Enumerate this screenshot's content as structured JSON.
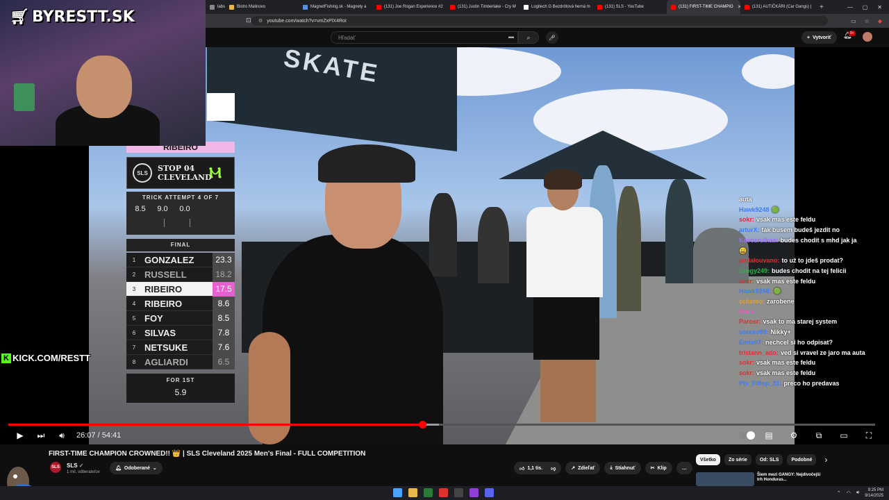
{
  "browser": {
    "tabs": [
      {
        "label": "labs",
        "color": "#888"
      },
      {
        "label": "Bistro Malinovo",
        "color": "#e8b84a"
      },
      {
        "label": "MagnetFishing.sk - Magnety a",
        "color": "#5a8de0"
      },
      {
        "label": "(131) Joe Rogan Experience #2",
        "color": "#ff0000"
      },
      {
        "label": "(131) Justin Timberlake - Cry M",
        "color": "#ff0000"
      },
      {
        "label": "Logitech G Bezdrôtová herná m",
        "color": "#ffffff"
      },
      {
        "label": "(131) SLS - YouTube",
        "color": "#ff0000"
      },
      {
        "label": "(131) FIRST-TIME CHAMPIO",
        "color": "#ff0000",
        "active": true
      },
      {
        "label": "(131) AUTIČKÁRI (Car Gangs) |",
        "color": "#ff0000"
      }
    ],
    "new_tab": "+",
    "window_controls": [
      "—",
      "▢",
      "✕"
    ],
    "url": "youtube.com/watch?v=vmZxPlX4RoI"
  },
  "youtube": {
    "search_placeholder": "Hľadať",
    "create_label": "Vytvoriť",
    "notif_badge": "9+",
    "video_title": "FIRST-TIME CHAMPION CROWNED!! 👑 | SLS Cleveland 2025 Men's Final - FULL COMPETITION",
    "channel": {
      "name": "SLS",
      "subs": "1 mil. odberateľov",
      "avatar_text": "SLS"
    },
    "subscribed_label": "Odoberané",
    "actions": {
      "likes": "1,1 tis.",
      "share": "Zdieľať",
      "download": "Stiahnuť",
      "clip": "Klip",
      "more": "…"
    },
    "chips": [
      "Všetko",
      "Zo série",
      "Od: SLS",
      "Podobné"
    ],
    "recommended_title": "Šiem mezi GANGY: Nejdivočejší trh Honduras..."
  },
  "player": {
    "current_time": "26:07",
    "duration": "54:41",
    "progress_fraction": 0.4776,
    "buffered_fraction": 0.497
  },
  "scoreboard": {
    "current_name": "RIBEIRO",
    "event_logo": "SLS",
    "stop_line1": "STOP 04",
    "stop_line2": "CLEVELAND",
    "trick_title": "TRICK ATTEMPT 4 OF 7",
    "trick_scores": [
      "8.5",
      "9.0",
      "0.0"
    ],
    "final_title": "FINAL",
    "rows": [
      {
        "pos": "1",
        "name": "GONZALEZ",
        "score": "23.3",
        "style": ""
      },
      {
        "pos": "2",
        "name": "RUSSELL",
        "score": "18.2",
        "style": "dim"
      },
      {
        "pos": "3",
        "name": "RIBEIRO",
        "score": "17.5",
        "style": "hl"
      },
      {
        "pos": "4",
        "name": "RIBEIRO",
        "score": "8.6",
        "style": ""
      },
      {
        "pos": "5",
        "name": "FOY",
        "score": "8.5",
        "style": ""
      },
      {
        "pos": "6",
        "name": "SILVAS",
        "score": "7.8",
        "style": ""
      },
      {
        "pos": "7",
        "name": "NETSUKE",
        "score": "7.6",
        "style": ""
      },
      {
        "pos": "8",
        "name": "AGLIARDI",
        "score": "6.5",
        "style": "dim"
      }
    ],
    "for_label": "FOR 1ST",
    "for_value": "5.9"
  },
  "stream": {
    "logo": "BYRESTT.SK",
    "kick_url": "KICK.COM/RESTT",
    "chat": [
      {
        "user": "",
        "msg": "auta",
        "color": "#fff"
      },
      {
        "user": "Hawk9248",
        "msg": "🟢",
        "color": "#3b7cff"
      },
      {
        "user": "sokr:",
        "msg": "vsak mas este feldu",
        "color": "#e03030"
      },
      {
        "user": "arturX:",
        "msg": "tak busem budeš jezdit no",
        "color": "#3b7cff"
      },
      {
        "user": "Kavozrutkaa:",
        "msg": "budes chodit s mhd jak ja",
        "color": "#9f6bff"
      },
      {
        "user": "",
        "msg": "😄",
        "color": "#fff"
      },
      {
        "user": "padalouvano:",
        "msg": "to už to jdeš prodat?",
        "color": "#e03030"
      },
      {
        "user": "Gregy249:",
        "msg": "budes chodit na tej felicii",
        "color": "#2fb24a"
      },
      {
        "user": "sokr:",
        "msg": "vsak mas este feldu",
        "color": "#e03030"
      },
      {
        "user": "Hawk9248:",
        "msg": "🟢",
        "color": "#3b7cff"
      },
      {
        "user": "schemo:",
        "msg": "zarobene",
        "color": "#e0a030"
      },
      {
        "user": "Pana",
        "msg": "",
        "color": "#ff4fd0"
      },
      {
        "user": "Parosr:",
        "msg": "vsak to ma starej system",
        "color": "#e03030"
      },
      {
        "user": "sorexo99:",
        "msg": "Nikky+",
        "color": "#3b7cff"
      },
      {
        "user": "Emte07:",
        "msg": "nechcel si ho odpisat?",
        "color": "#3b7cff"
      },
      {
        "user": "tristann_ado:",
        "msg": "ved si vravel ze jaro ma auta",
        "color": "#e03030",
        "wrap": true
      },
      {
        "user": "sokr:",
        "msg": "vsak mas este feldu",
        "color": "#e03030"
      },
      {
        "user": "sokr:",
        "msg": "vsak mas este feldu",
        "color": "#e03030"
      },
      {
        "user": "Ptv_Fiflop_31:",
        "msg": "preco ho predavas",
        "color": "#3b7cff"
      }
    ]
  },
  "taskbar": {
    "time": "9:25 PM",
    "date": "9/14/2025"
  }
}
